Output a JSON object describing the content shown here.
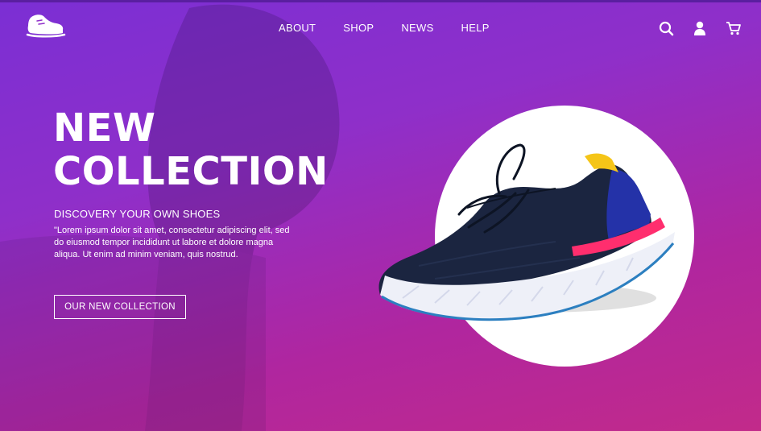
{
  "nav": {
    "items": [
      {
        "label": "ABOUT"
      },
      {
        "label": "SHOP"
      },
      {
        "label": "NEWS"
      },
      {
        "label": "HELP"
      }
    ]
  },
  "header_icons": [
    "search-icon",
    "user-icon",
    "cart-icon"
  ],
  "logo_icon": "shoe-logo-icon",
  "hero": {
    "title_line1": "NEW",
    "title_line2": "COLLECTION",
    "subtitle": "DISCOVERY YOUR OWN SHOES",
    "description": "\"Lorem ipsum dolor sit amet, consectetur adipiscing elit, sed do eiusmod tempor incididunt ut labore et dolore magna aliqua. Ut enim ad minim veniam, quis nostrud.",
    "cta_label": "OUR NEW COLLECTION"
  },
  "colors": {
    "gradient_top": "#7b2fd4",
    "gradient_bottom": "#c22a8a",
    "text": "#ffffff",
    "shoe_upper": "#1b2540",
    "shoe_heel": "#2432a8",
    "shoe_accent": "#ff2e6e",
    "shoe_tab": "#f5c518"
  }
}
